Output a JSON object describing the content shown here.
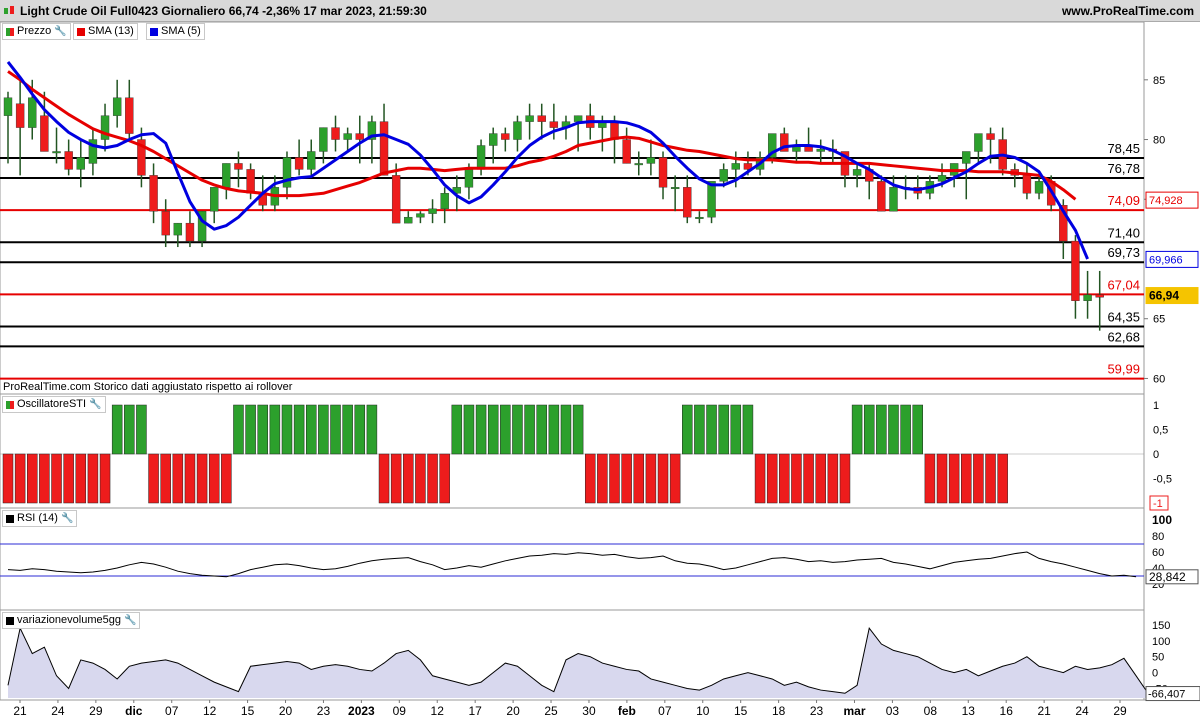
{
  "window": {
    "title": "Light Crude Oil Full0423 Giornaliero 66,74 -2,36% 17 mar 2023, 21:59:30",
    "site": "www.ProRealTime.com"
  },
  "legend": {
    "price": "Prezzo",
    "sma13": "SMA (13)",
    "sma5": "SMA (5)",
    "osc": "OscillatoreSTI",
    "rsi": "RSI (14)",
    "vol": "variazionevolume5gg"
  },
  "footnote": "ProRealTime.com  Storico dati aggiustato rispetto ai rollover",
  "colors": {
    "up": "#2ca02c",
    "down": "#ee1c1c",
    "sma13": "#e60000",
    "sma5": "#0000e0",
    "line_black": "#000000",
    "rsi_line": "#000000",
    "rsi_band": "#2b2bd6",
    "vol_fill": "#d8d8ee"
  },
  "chart_data": [
    {
      "type": "candlestick",
      "title": "Light Crude Oil Full0423 Giornaliero",
      "ylim": [
        59.2,
        88.5
      ],
      "y_ticks": [
        60,
        65,
        75,
        80,
        85
      ],
      "x_ticks": [
        "21",
        "24",
        "29",
        "dic",
        "07",
        "12",
        "15",
        "20",
        "23",
        "2023",
        "09",
        "12",
        "17",
        "20",
        "25",
        "30",
        "feb",
        "07",
        "10",
        "15",
        "18",
        "23",
        "mar",
        "03",
        "08",
        "13",
        "16",
        "21",
        "24",
        "29"
      ],
      "ohlc": [
        [
          82,
          84,
          78,
          83.5
        ],
        [
          83,
          85,
          77,
          81
        ],
        [
          81,
          85,
          80,
          83.5
        ],
        [
          82,
          84,
          79,
          79
        ],
        [
          79,
          81,
          78,
          79
        ],
        [
          79,
          80,
          77,
          77.5
        ],
        [
          77.5,
          80,
          76,
          78.5
        ],
        [
          78,
          81,
          77,
          80
        ],
        [
          80,
          83,
          79,
          82
        ],
        [
          82,
          85,
          81,
          83.5
        ],
        [
          83.5,
          85,
          80,
          80.5
        ],
        [
          80,
          81,
          76,
          77
        ],
        [
          77,
          78,
          73,
          74
        ],
        [
          74,
          75,
          71,
          72
        ],
        [
          72,
          73,
          71,
          73
        ],
        [
          73,
          74,
          71,
          71.5
        ],
        [
          71.5,
          74,
          71,
          74
        ],
        [
          74,
          76,
          73,
          76
        ],
        [
          76,
          78,
          75,
          78
        ],
        [
          78,
          79,
          76,
          77.5
        ],
        [
          77.5,
          78,
          75,
          75.5
        ],
        [
          75.5,
          77,
          74,
          74.5
        ],
        [
          74.5,
          77,
          74,
          76
        ],
        [
          76,
          79,
          75,
          78.5
        ],
        [
          78.5,
          80,
          77,
          77.5
        ],
        [
          77.5,
          80,
          77,
          79
        ],
        [
          79,
          81,
          78,
          81
        ],
        [
          81,
          82,
          79,
          80
        ],
        [
          80,
          81,
          79,
          80.5
        ],
        [
          80.5,
          82,
          78,
          80
        ],
        [
          80,
          82,
          78,
          81.5
        ],
        [
          81.5,
          83,
          77,
          77
        ],
        [
          77,
          78,
          73,
          73
        ],
        [
          73,
          74,
          73,
          73.5
        ],
        [
          73.5,
          74,
          73,
          73.8
        ],
        [
          73.8,
          75,
          73,
          74.2
        ],
        [
          74.2,
          76,
          73,
          75.5
        ],
        [
          75.5,
          77,
          74,
          76
        ],
        [
          76,
          78,
          75,
          77.5
        ],
        [
          77.5,
          80,
          77,
          79.5
        ],
        [
          79.5,
          81,
          78,
          80.5
        ],
        [
          80.5,
          81,
          79,
          80
        ],
        [
          80,
          82,
          79,
          81.5
        ],
        [
          81.5,
          83,
          80,
          82
        ],
        [
          82,
          83,
          80,
          81.5
        ],
        [
          81.5,
          83,
          80,
          81
        ],
        [
          81,
          82,
          80,
          81.5
        ],
        [
          81.5,
          82,
          79,
          82
        ],
        [
          82,
          83,
          80,
          81
        ],
        [
          81,
          82,
          79,
          81.5
        ],
        [
          81.5,
          82,
          78,
          80
        ],
        [
          80,
          81,
          78,
          78
        ],
        [
          78,
          79,
          77,
          78
        ],
        [
          78,
          80,
          77,
          78.5
        ],
        [
          78.5,
          79,
          75,
          76
        ],
        [
          76,
          77,
          74,
          76
        ],
        [
          76,
          77,
          73,
          73.5
        ],
        [
          73.5,
          74,
          73,
          73.5
        ],
        [
          73.5,
          76,
          73,
          76.5
        ],
        [
          76.5,
          78,
          76,
          77.5
        ],
        [
          77.5,
          79,
          76,
          78
        ],
        [
          78,
          79,
          77,
          77.5
        ],
        [
          77.5,
          79,
          77,
          78.5
        ],
        [
          78.5,
          80,
          78,
          80.5
        ],
        [
          80.5,
          81,
          79,
          79
        ],
        [
          79,
          80,
          78,
          79.5
        ],
        [
          79.5,
          81,
          79,
          79
        ],
        [
          79,
          80,
          78,
          79.2
        ],
        [
          79.2,
          80,
          78,
          79
        ],
        [
          79,
          79,
          76,
          77
        ],
        [
          77,
          78,
          76,
          77.5
        ],
        [
          77.5,
          78,
          75,
          76.5
        ],
        [
          76.5,
          77,
          74,
          74
        ],
        [
          74,
          77,
          74,
          76
        ],
        [
          76,
          77,
          75,
          76
        ],
        [
          76,
          77,
          75,
          75.5
        ],
        [
          75.5,
          77,
          75,
          76.5
        ],
        [
          76.5,
          78,
          76,
          77
        ],
        [
          77,
          78,
          76,
          78
        ],
        [
          78,
          79,
          75,
          79
        ],
        [
          79,
          80,
          78,
          80.5
        ],
        [
          80.5,
          81,
          78,
          80
        ],
        [
          80,
          81,
          77,
          77.5
        ],
        [
          77.5,
          78,
          76,
          77
        ],
        [
          77,
          78,
          75,
          75.5
        ],
        [
          75.5,
          77,
          75,
          76.5
        ],
        [
          76.5,
          77,
          74,
          74.5
        ],
        [
          74.5,
          75,
          70,
          71.5
        ],
        [
          71.5,
          72,
          65,
          66.5
        ],
        [
          66.5,
          69,
          65,
          67
        ],
        [
          67,
          69,
          64,
          66.8
        ]
      ]
    },
    {
      "type": "line",
      "series": [
        {
          "name": "SMA (13)",
          "values": [
            85.7,
            85,
            84.2,
            83.5,
            82.8,
            82.1,
            81.5,
            80.9,
            80.5,
            80.2,
            79.9,
            79.5,
            79,
            78.4,
            77.8,
            77.2,
            76.6,
            76.2,
            75.9,
            75.7,
            75.6,
            75.5,
            75.3,
            75.3,
            75.3,
            75.4,
            75.5,
            75.8,
            76.1,
            76.4,
            76.8,
            77.2,
            77.4,
            77.6,
            77.6,
            77.5,
            77.4,
            77.5,
            77.6,
            77.6,
            77.6,
            77.6,
            77.8,
            78.1,
            78.3,
            78.6,
            79,
            79.5,
            79.7,
            79.9,
            80.1,
            80.2,
            80.1,
            79.8,
            79.5,
            79.3,
            79.1,
            79,
            78.8,
            78.6,
            78.4,
            78.3,
            78.3,
            78.3,
            78.2,
            78.1,
            78.1,
            78,
            78,
            78,
            78,
            78,
            77.9,
            77.8,
            77.7,
            77.6,
            77.5,
            77.4,
            77.4,
            77.4,
            77.3,
            77.3,
            77.3,
            77.2,
            77.1,
            77,
            76.5,
            75.8,
            75
          ]
        },
        {
          "name": "SMA (5)",
          "values": [
            86.5,
            85.2,
            83.8,
            82.5,
            81.5,
            80.6,
            80,
            79.5,
            79.3,
            79.5,
            80,
            80.4,
            80.5,
            79.7,
            77.2,
            74.8,
            73.2,
            72.5,
            72.8,
            73.5,
            74.5,
            75.5,
            76.3,
            76.6,
            76.8,
            76.9,
            77.6,
            78.3,
            79,
            79.7,
            80.3,
            80.4,
            80,
            79.6,
            78.7,
            77.5,
            76.2,
            75.3,
            74.7,
            75.2,
            76.2,
            77.3,
            78.5,
            79.5,
            80.2,
            80.7,
            81,
            81.4,
            81.5,
            81.5,
            81.5,
            81.4,
            81.1,
            80.6,
            79.7,
            78.6,
            77.6,
            76.7,
            76.2,
            76.2,
            76.6,
            77.3,
            78,
            78.9,
            79.4,
            79.5,
            79.5,
            79.4,
            79.1,
            78.6,
            78,
            77.5,
            76.8,
            76.2,
            75.9,
            75.8,
            76,
            76.3,
            76.8,
            77.3,
            78,
            78.6,
            78.7,
            78.5,
            78,
            77.3,
            75.7,
            74,
            72.4,
            70
          ]
        }
      ]
    },
    {
      "type": "levels",
      "horizontal_levels": [
        {
          "label": "78,45",
          "value": 78.45,
          "color": "#000000"
        },
        {
          "label": "76,78",
          "value": 76.78,
          "color": "#000000"
        },
        {
          "label": "74,09",
          "value": 74.09,
          "color": "#e60000"
        },
        {
          "label": "71,40",
          "value": 71.4,
          "color": "#000000"
        },
        {
          "label": "69,73",
          "value": 69.73,
          "color": "#000000"
        },
        {
          "label": "67,04",
          "value": 67.04,
          "color": "#e60000"
        },
        {
          "label": "64,35",
          "value": 64.35,
          "color": "#000000"
        },
        {
          "label": "62,68",
          "value": 62.68,
          "color": "#000000"
        },
        {
          "label": "59,99",
          "value": 59.99,
          "color": "#e60000"
        }
      ],
      "last_value_tags": [
        {
          "label": "74,928",
          "value": 74.928,
          "color": "#e60000"
        },
        {
          "label": "69,966",
          "value": 69.966,
          "color": "#0000e0"
        },
        {
          "label": "66,94",
          "value": 66.94,
          "color": "#f5c400"
        }
      ]
    },
    {
      "type": "bar",
      "title": "OscillatoreSTI",
      "ylim": [
        -1,
        1
      ],
      "y_ticks": [
        "1",
        "0,5",
        "0",
        "-0,5",
        "-1"
      ],
      "last_value_label": "-1",
      "values": [
        -1,
        -1,
        -1,
        -1,
        -1,
        -1,
        -1,
        -1,
        -1,
        1,
        1,
        1,
        -1,
        -1,
        -1,
        -1,
        -1,
        -1,
        -1,
        1,
        1,
        1,
        1,
        1,
        1,
        1,
        1,
        1,
        1,
        1,
        1,
        -1,
        -1,
        -1,
        -1,
        -1,
        -1,
        1,
        1,
        1,
        1,
        1,
        1,
        1,
        1,
        1,
        1,
        1,
        -1,
        -1,
        -1,
        -1,
        -1,
        -1,
        -1,
        -1,
        1,
        1,
        1,
        1,
        1,
        1,
        -1,
        -1,
        -1,
        -1,
        -1,
        -1,
        -1,
        -1,
        1,
        1,
        1,
        1,
        1,
        1,
        -1,
        -1,
        -1,
        -1,
        -1,
        -1,
        -1
      ]
    },
    {
      "type": "line",
      "title": "RSI (14)",
      "ylim": [
        0,
        100
      ],
      "y_ticks": [
        100,
        80,
        60,
        40,
        20
      ],
      "bands": [
        70,
        30
      ],
      "last_value_label": "28,842",
      "values": [
        38,
        37,
        39,
        38,
        36,
        35,
        34,
        35,
        37,
        40,
        44,
        47,
        45,
        41,
        36,
        33,
        31,
        30,
        29,
        33,
        38,
        41,
        44,
        45,
        43,
        40,
        38,
        39,
        42,
        46,
        49,
        51,
        52,
        53,
        48,
        44,
        38,
        40,
        43,
        41,
        45,
        49,
        52,
        55,
        56,
        58,
        57,
        59,
        58,
        56,
        57,
        54,
        52,
        53,
        55,
        49,
        46,
        45,
        42,
        38,
        40,
        44,
        48,
        52,
        53,
        51,
        48,
        49,
        47,
        48,
        50,
        51,
        52,
        47,
        45,
        42,
        39,
        43,
        47,
        49,
        51,
        52,
        55,
        58,
        60,
        52,
        48,
        45,
        41,
        37,
        33,
        30,
        31,
        29
      ]
    },
    {
      "type": "area",
      "title": "variazionevolume5gg",
      "ylim": [
        -80,
        150
      ],
      "y_ticks": [
        150,
        100,
        50,
        0,
        -50
      ],
      "last_value_label": "-66,407",
      "values": [
        -40,
        140,
        60,
        80,
        -10,
        -50,
        40,
        30,
        10,
        -20,
        20,
        30,
        35,
        40,
        30,
        10,
        -10,
        -30,
        -45,
        -60,
        20,
        25,
        30,
        35,
        30,
        10,
        20,
        25,
        20,
        10,
        5,
        30,
        60,
        70,
        40,
        -10,
        -20,
        -30,
        -40,
        -30,
        0,
        30,
        20,
        -10,
        -40,
        -60,
        40,
        60,
        50,
        30,
        20,
        10,
        5,
        -20,
        -30,
        -40,
        -50,
        -55,
        -40,
        -20,
        -10,
        0,
        -10,
        -20,
        -40,
        -30,
        -45,
        -55,
        -60,
        -65,
        -40,
        140,
        90,
        70,
        60,
        50,
        30,
        10,
        0,
        10,
        -10,
        5,
        20,
        30,
        50,
        20,
        10,
        0,
        20,
        10,
        15,
        25,
        45,
        -10,
        -66
      ]
    }
  ]
}
